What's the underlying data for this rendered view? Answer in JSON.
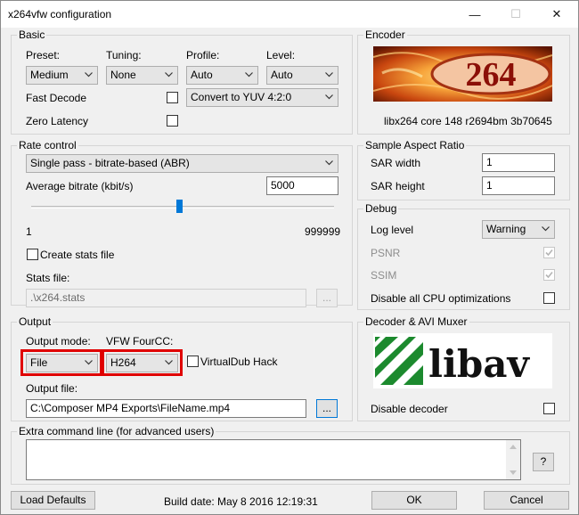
{
  "window": {
    "title": "x264vfw configuration",
    "minimize_glyph": "—",
    "maximize_glyph": "☐",
    "close_glyph": "✕"
  },
  "basic": {
    "label": "Basic",
    "preset_label": "Preset:",
    "preset_value": "Medium",
    "tuning_label": "Tuning:",
    "tuning_value": "None",
    "profile_label": "Profile:",
    "profile_value": "Auto",
    "level_label": "Level:",
    "level_value": "Auto",
    "fast_decode_label": "Fast Decode",
    "fast_decode_checked": false,
    "zero_latency_label": "Zero Latency",
    "zero_latency_checked": false,
    "colorspace_value": "Convert to YUV 4:2:0"
  },
  "encoder": {
    "label": "Encoder",
    "logo_text": "264",
    "version": "libx264 core 148 r2694bm 3b70645"
  },
  "rate_control": {
    "label": "Rate control",
    "mode_value": "Single pass - bitrate-based (ABR)",
    "bitrate_label": "Average bitrate (kbit/s)",
    "bitrate_value": "5000",
    "slider_min": "1",
    "slider_max": "999999",
    "slider_fraction": 0.49,
    "create_stats_label": "Create stats file",
    "create_stats_checked": false,
    "stats_file_label": "Stats file:",
    "stats_file_value": ".\\x264.stats",
    "browse_label": "..."
  },
  "sar": {
    "label": "Sample Aspect Ratio",
    "width_label": "SAR width",
    "width_value": "1",
    "height_label": "SAR height",
    "height_value": "1"
  },
  "debug": {
    "label": "Debug",
    "log_level_label": "Log level",
    "log_level_value": "Warning",
    "psnr_label": "PSNR",
    "psnr_checked": true,
    "ssim_label": "SSIM",
    "ssim_checked": true,
    "disable_cpu_label": "Disable all CPU optimizations",
    "disable_cpu_checked": false
  },
  "output": {
    "label": "Output",
    "mode_label": "Output mode:",
    "mode_value": "File",
    "fourcc_label": "VFW FourCC:",
    "fourcc_value": "H264",
    "virtualdub_label": "VirtualDub Hack",
    "virtualdub_checked": false,
    "file_label": "Output file:",
    "file_value": "C:\\Composer MP4 Exports\\FileName.mp4",
    "browse_label": "...",
    "highlight_color": "#e00000"
  },
  "decoder": {
    "label": "Decoder & AVI Muxer",
    "logo_text": "libav",
    "disable_label": "Disable decoder",
    "disable_checked": false
  },
  "extra": {
    "label": "Extra command line (for advanced users)",
    "value": "",
    "help_label": "?"
  },
  "footer": {
    "load_defaults_label": "Load Defaults",
    "build_date": "Build date: May  8 2016 12:19:31",
    "ok_label": "OK",
    "cancel_label": "Cancel"
  }
}
